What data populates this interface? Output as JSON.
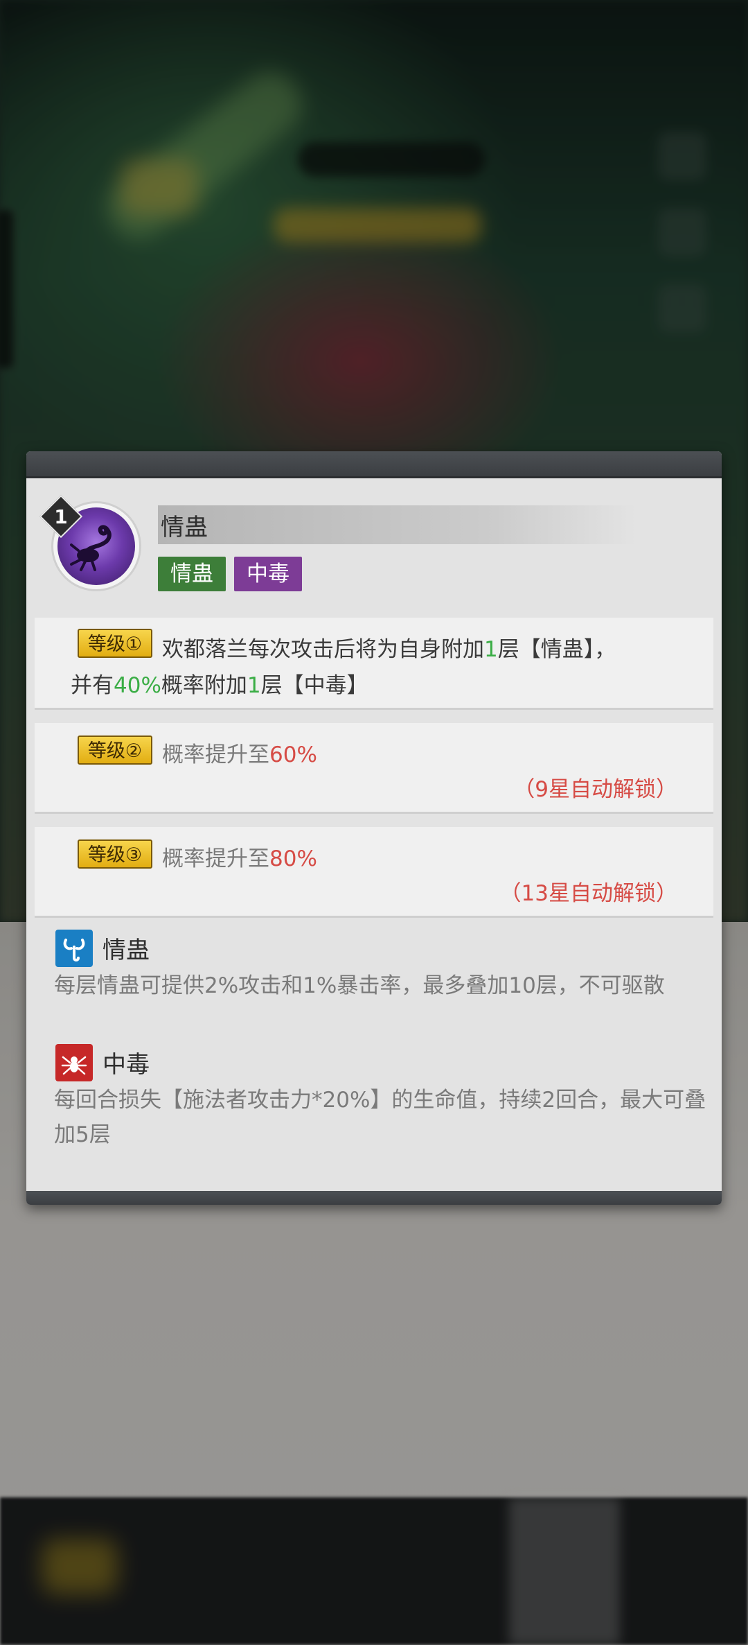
{
  "skill": {
    "level": "1",
    "name": "情蛊",
    "tags": [
      "情蛊",
      "中毒"
    ],
    "tag_colors": [
      "#3d7e39",
      "#7d3c96"
    ]
  },
  "levels": [
    {
      "tag": "等级①",
      "line1": {
        "a": "欢都落兰每次攻击后将为自身附加",
        "b": "1",
        "c": "层【情蛊】，"
      },
      "line2": {
        "a": "并有",
        "b": "40%",
        "c": "概率附加",
        "d": "1",
        "e": "层【中毒】"
      }
    },
    {
      "tag": "等级②",
      "line": {
        "a": "概率提升至",
        "b": "60%"
      },
      "unlock": "（9星自动解锁）"
    },
    {
      "tag": "等级③",
      "line": {
        "a": "概率提升至",
        "b": "80%"
      },
      "unlock": "（13星自动解锁）"
    }
  ],
  "buffs": [
    {
      "name": "情蛊",
      "icon": "scorpion-icon",
      "icon_color": "#1a7fc4",
      "desc": "每层情蛊可提供2%攻击和1%暴击率，最多叠加10层，不可驱散"
    },
    {
      "name": "中毒",
      "icon": "spider-icon",
      "icon_color": "#c62828",
      "desc": "每回合损失【施法者攻击力*20%】的生命值，持续2回合，最大可叠加5层"
    }
  ]
}
